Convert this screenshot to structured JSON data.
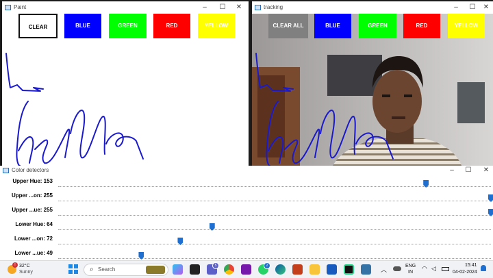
{
  "paint_window": {
    "title": "Paint",
    "buttons": [
      {
        "label": "CLEAR",
        "color": "#ffffff",
        "text_color": "#000000",
        "selected": true
      },
      {
        "label": "BLUE",
        "color": "#0000ff",
        "text_color": "#ffffff"
      },
      {
        "label": "GREEN",
        "color": "#00ff00",
        "text_color": "#ffffff"
      },
      {
        "label": "RED",
        "color": "#ff0000",
        "text_color": "#ffffff"
      },
      {
        "label": "YELLOW",
        "color": "#ffff00",
        "text_color": "#ffffff"
      }
    ]
  },
  "tracking_window": {
    "title": "tracking",
    "buttons": [
      {
        "label": "CLEAR ALL",
        "color": "#808080",
        "text_color": "#ffffff"
      },
      {
        "label": "BLUE",
        "color": "#0000ff",
        "text_color": "#ffffff"
      },
      {
        "label": "GREEN",
        "color": "#00ff00",
        "text_color": "#ffffff"
      },
      {
        "label": "RED",
        "color": "#ff0000",
        "text_color": "#ffffff"
      },
      {
        "label": "YELLOW",
        "color": "#ffff00",
        "text_color": "#ffffff"
      }
    ]
  },
  "color_detectors_window": {
    "title": "Color detectors",
    "sliders": [
      {
        "label": "Upper Hue: 153",
        "value": 153,
        "max": 180
      },
      {
        "label": "Upper ...on: 255",
        "value": 255,
        "max": 255
      },
      {
        "label": "Upper ...ue: 255",
        "value": 255,
        "max": 255
      },
      {
        "label": "Lower Hue: 64",
        "value": 64,
        "max": 180
      },
      {
        "label": "Lower ...on: 72",
        "value": 72,
        "max": 255
      },
      {
        "label": "Lower ...ue: 49",
        "value": 49,
        "max": 255
      }
    ]
  },
  "taskbar": {
    "weather_temp": "32°C",
    "weather_desc": "Sunny",
    "weather_badge": "!",
    "search_placeholder": "Search",
    "badge_a": "5",
    "badge_b": "2",
    "lang_top": "ENG",
    "lang_bottom": "IN",
    "time": "15:41",
    "date": "04-02-2024"
  },
  "colors": {
    "stroke": "#1a1acc",
    "thumb": "#1e6fd0"
  }
}
